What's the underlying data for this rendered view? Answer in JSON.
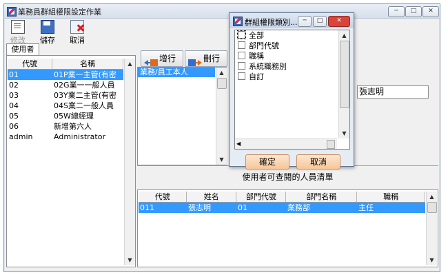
{
  "window": {
    "title": "業務員群組權限設定作業",
    "controls": {
      "minimize": "─",
      "maximize": "□",
      "close": "✕"
    }
  },
  "toolbar": {
    "edit_label": "修改",
    "save_label": "儲存",
    "cancel_label": "取消"
  },
  "tabs": [
    {
      "label": "使用者"
    }
  ],
  "users_table": {
    "headers": [
      "代號",
      "名稱"
    ],
    "rows": [
      {
        "code": "01",
        "name": "01P業一主管(有密"
      },
      {
        "code": "02",
        "name": "02G業一一般人員"
      },
      {
        "code": "03",
        "name": "03Y業二主管(有密"
      },
      {
        "code": "04",
        "name": "04S業二一般人員"
      },
      {
        "code": "05",
        "name": "05W總經理"
      },
      {
        "code": "06",
        "name": "新增第六人"
      },
      {
        "code": "admin",
        "name": "Administrator"
      }
    ],
    "selected_index": 0
  },
  "row_buttons": {
    "add_label": "增行",
    "delete_label": "刪行"
  },
  "group_list": {
    "items": [
      "業務/員工本人"
    ],
    "selected_index": 0
  },
  "name_field": {
    "value": "張志明"
  },
  "viewable_list": {
    "title": "使用者可查閱的人員清單",
    "headers": [
      "代號",
      "姓名",
      "部門代號",
      "部門名稱",
      "職稱"
    ],
    "rows": [
      {
        "code": "011",
        "name": "張志明",
        "dept_code": "01",
        "dept_name": "業務部",
        "title": "主任"
      }
    ]
  },
  "dialog": {
    "title": "群組權限類別...",
    "options": [
      {
        "label": "全部",
        "checked": false
      },
      {
        "label": "部門代號",
        "checked": false
      },
      {
        "label": "職稱",
        "checked": false
      },
      {
        "label": "系統職務別",
        "checked": false
      },
      {
        "label": "自訂",
        "checked": false
      }
    ],
    "ok_label": "確定",
    "cancel_label": "取消"
  },
  "colors": {
    "selection": "#3399ff",
    "dialog_close": "#d9443b",
    "dialog_button": "#f6c699"
  }
}
